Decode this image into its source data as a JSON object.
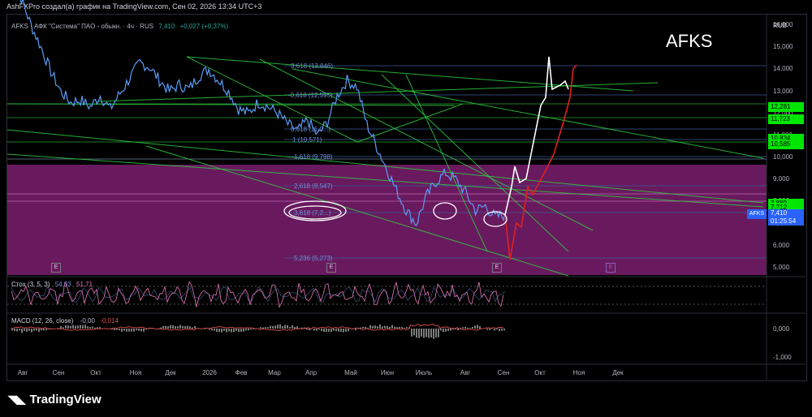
{
  "header_text": "AshFXPro создал(а) график на TradingView.com, Сен 02, 2026 13:34 UTC+3",
  "symbol_title": "AFKS",
  "legend": {
    "name": "AFKS · АФК \"Система\" ПАО - обыкн. · 4ч · RUS",
    "last": "7,410",
    "change": "+0,027 (+0,37%)"
  },
  "currency": "RUB",
  "current_tag": {
    "symbol": "AFKS",
    "price": "7,410",
    "countdown": "01:25:54"
  },
  "level_tags": [
    {
      "value": "12,281",
      "color": "#00e600"
    },
    {
      "value": "11,723",
      "color": "#00e600"
    },
    {
      "value": "10,834",
      "color": "#00e600"
    },
    {
      "value": "10,585",
      "color": "#00e600"
    },
    {
      "value": "7,889",
      "color": "#00e600"
    },
    {
      "value": "7,712",
      "color": "#00e600"
    }
  ],
  "fib_labels": [
    "3,618 (13,846)",
    "-0,618 (12,595)",
    "0,618 (11,0...)",
    "1 (10,571)",
    "1,618 (9,798)",
    "2,618 (8,547)",
    "3,618 (7,2...)",
    "5,236 (5,273)"
  ],
  "indicators": {
    "stoch": {
      "label": "Стох (3, 5, 3)",
      "k": "54,33",
      "d": "51,71"
    },
    "macd": {
      "label": "MACD (12, 26, close)",
      "v1": "-0,00",
      "v2": "-0,014"
    }
  },
  "macd_axis": [
    "0,000",
    "-1,000"
  ],
  "tv_logo_text": "TradingView",
  "colors": {
    "price": "#5b9cf6",
    "bg": "#000000",
    "zone": "#7b1f6e",
    "trend": "#2ecc40",
    "forecast_up": "#ffffff",
    "forecast_alt": "#e02020"
  },
  "chart_data": {
    "type": "line",
    "title": "",
    "series": [
      {
        "name": "AFKS",
        "values": [
          18.5,
          17.2,
          16.0,
          15.0,
          13.9,
          13.0,
          12.5,
          12.6,
          12.3,
          12.8,
          12.2,
          12.9,
          13.6,
          14.3,
          14.1,
          13.5,
          13.0,
          13.3,
          13.1,
          13.7,
          14.0,
          13.5,
          13.0,
          12.2,
          12.0,
          12.5,
          12.3,
          12.0,
          11.5,
          11.2,
          11.7,
          11.0,
          11.6,
          12.8,
          13.5,
          13.2,
          11.5,
          10.5,
          9.5,
          8.5,
          7.6,
          7.0,
          8.2,
          8.9,
          9.3,
          9.0,
          8.4,
          7.6,
          7.8,
          7.3,
          7.41
        ]
      }
    ],
    "ylim": [
      4.6,
      16.0
    ],
    "y_ticks": [
      "16,000",
      "15,000",
      "14,000",
      "13,000",
      "12,000",
      "11,000",
      "10,000",
      "9,000",
      "8,000",
      "7,000",
      "6,000",
      "5,000"
    ],
    "x_ticks": [
      "Авг",
      "Сен",
      "Окт",
      "Ноя",
      "Дек",
      "2026",
      "Фев",
      "Мар",
      "Апр",
      "Май",
      "Июн",
      "Июль",
      "Авг",
      "Сен",
      "Окт",
      "Ноя",
      "Дек"
    ],
    "stoch_ticks": [],
    "macd_ticks": [
      "0,000",
      "-1,000"
    ]
  }
}
